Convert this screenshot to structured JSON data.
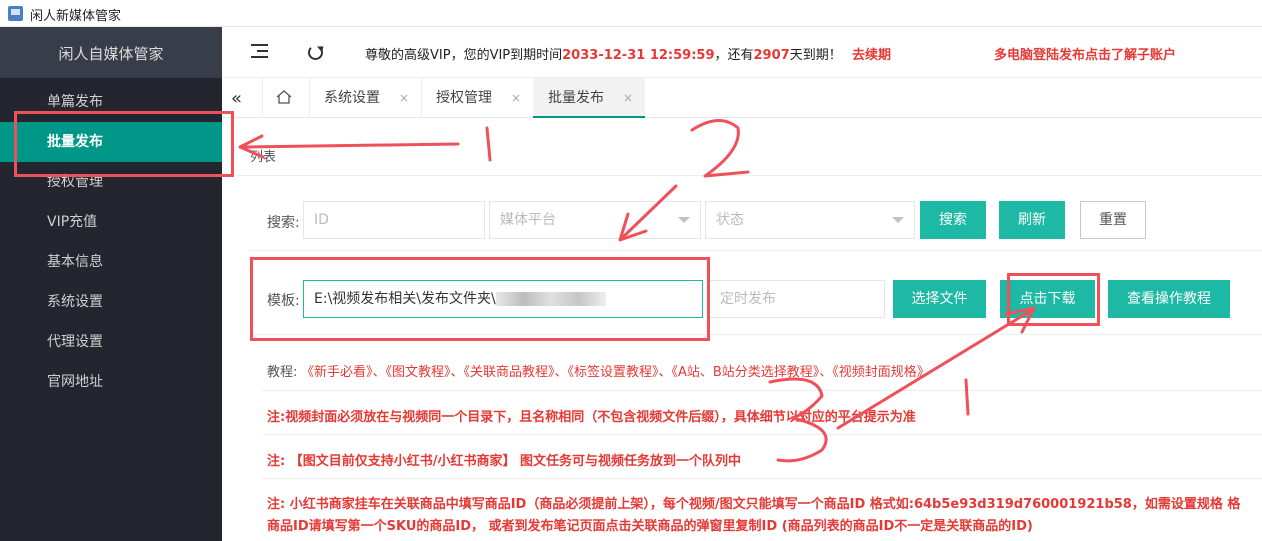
{
  "window": {
    "title": "闲人新媒体管家"
  },
  "sidebar": {
    "logo": "闲人自媒体管家",
    "items": [
      {
        "label": "单篇发布",
        "active": false
      },
      {
        "label": "批量发布",
        "active": true
      },
      {
        "label": "授权管理",
        "active": false
      },
      {
        "label": "VIP充值",
        "active": false
      },
      {
        "label": "基本信息",
        "active": false
      },
      {
        "label": "系统设置",
        "active": false
      },
      {
        "label": "代理设置",
        "active": false
      },
      {
        "label": "官网地址",
        "active": false
      }
    ]
  },
  "header": {
    "notice_prefix": "尊敬的高级VIP，您的VIP到期时间",
    "expiry": "2033-12-31 12:59:59",
    "notice_mid": "，还有",
    "days_left": "2907",
    "notice_suffix": "天到期！",
    "renew_link": "去续期",
    "multi_login_notice": "多电脑登陆发布点击了解子账户"
  },
  "tabs": [
    {
      "label": "系统设置",
      "close": "×"
    },
    {
      "label": "授权管理",
      "close": "×"
    },
    {
      "label": "批量发布",
      "close": "×",
      "active": true
    }
  ],
  "content": {
    "subtitle": "列表",
    "search": {
      "label": "搜索:",
      "id_placeholder": "ID",
      "platform_placeholder": "媒体平台",
      "status_placeholder": "状态",
      "search_button": "搜索",
      "refresh_button": "刷新",
      "reset_button": "重置"
    },
    "template": {
      "label": "模板:",
      "path_value": "E:\\视频发布相关\\发布文件夹\\",
      "schedule_placeholder": "定时发布",
      "choose_file_button": "选择文件",
      "download_button": "点击下载",
      "tutorial_button": "查看操作教程"
    },
    "tutorial": {
      "label": "教程:",
      "links": "《新手必看》、《图文教程》、《关联商品教程》、《标签设置教程》、《A站、B站分类选择教程》、《视频封面规格》"
    },
    "notes": [
      "注:视频封面必须放在与视频同一个目录下，且名称相同（不包含视频文件后缀），具体细节以对应的平台提示为准",
      "注: 【图文目前仅支持小红书/小红书商家】 图文任务可与视频任务放到一个队列中",
      "注: 小红书商家挂车在关联商品中填写商品ID（商品必须提前上架），每个视频/图文只能填写一个商品ID 格式如:64b5e93d319d760001921b58，如需设置规格 格",
      "商品ID请填写第一个SKU的商品ID，  或者到发布笔记页面点击关联商品的弹窗里复制ID (商品列表的商品ID不一定是关联商品的ID)"
    ]
  },
  "colors": {
    "accent": "#009688",
    "button": "#1eb9a5",
    "warning": "#e53935",
    "annotation": "#f0505a"
  }
}
